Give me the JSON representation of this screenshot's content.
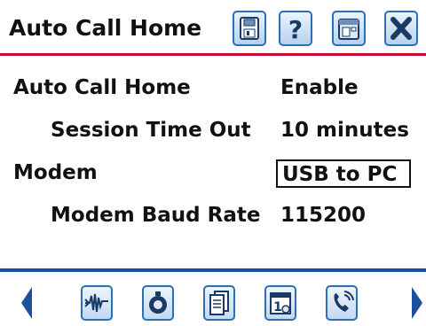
{
  "header": {
    "title": "Auto Call Home",
    "buttons": [
      {
        "name": "save-icon"
      },
      {
        "name": "help-icon"
      },
      {
        "name": "home-icon"
      },
      {
        "name": "close-icon"
      }
    ]
  },
  "settings": {
    "auto_call_home": {
      "label": "Auto Call Home",
      "value": "Enable"
    },
    "session_time_out": {
      "label": "Session Time Out",
      "value": "10 minutes"
    },
    "modem": {
      "label": "Modem",
      "value": "USB to PC"
    },
    "modem_baud_rate": {
      "label": "Modem Baud Rate",
      "value": "115200"
    }
  },
  "toolbar": {
    "icons": [
      "waveform-icon",
      "meter-icon",
      "documents-icon",
      "calendar-icon",
      "phone-icon"
    ],
    "left_arrow": "left-arrow-icon",
    "right_arrow": "right-arrow-icon"
  },
  "colors": {
    "accent_red": "#c8102e",
    "accent_blue": "#2a6fb8",
    "bottom_bar": "#1e4f9c"
  }
}
